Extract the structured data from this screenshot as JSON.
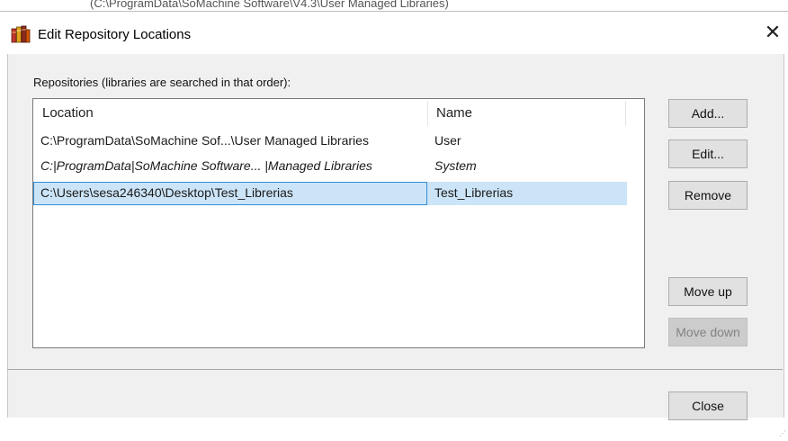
{
  "background_path": "(C:\\ProgramData\\SoMachine Software\\V4.3\\User Managed Libraries)",
  "window": {
    "title": "Edit Repository Locations",
    "close_glyph": "✕"
  },
  "repositories": {
    "label": "Repositories (libraries are searched in that order):",
    "columns": {
      "location": "Location",
      "name": "Name"
    },
    "rows": [
      {
        "location": "C:\\ProgramData\\SoMachine Sof...\\User Managed Libraries",
        "name": "User",
        "italic": false,
        "selected": false
      },
      {
        "location": "C:|ProgramData|SoMachine Software... |Managed Libraries",
        "name": "System",
        "italic": true,
        "selected": false
      },
      {
        "location": "C:\\Users\\sesa246340\\Desktop\\Test_Librerias",
        "name": "Test_Librerias",
        "italic": false,
        "selected": true
      }
    ]
  },
  "buttons": {
    "add": "Add...",
    "edit": "Edit...",
    "remove": "Remove",
    "move_up": "Move up",
    "move_down": "Move down",
    "close": "Close"
  },
  "colors": {
    "selection": "#cce4f7",
    "selection_border": "#2f8fd8",
    "dialog_bg": "#f0f0f0",
    "button_bg": "#e1e1e1"
  },
  "icons": {
    "app": "book-stack-icon",
    "close": "close-icon"
  }
}
